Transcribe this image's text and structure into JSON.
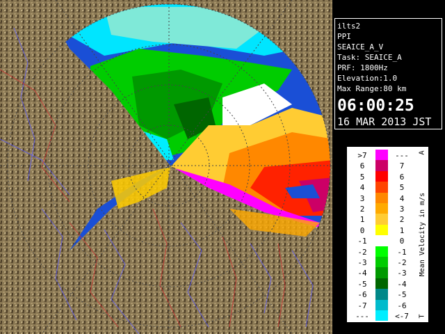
{
  "info": {
    "site": "ilts2",
    "scan_type": "PPI",
    "product": "SEAICE_A_V",
    "task": "Task: SEAICE_A",
    "prf": "PRF: 1800Hz",
    "elevation": "Elevation:1.0",
    "max_range": "Max Range:80 km",
    "time": "06:00:25",
    "date": "16 MAR 2013 JST"
  },
  "legend": {
    "title": "Mean Velocity in m/s",
    "corner_top": "A",
    "corner_bottom": "T",
    "rows": [
      {
        "left": ">7",
        "right": "---",
        "color": "#ff00ff"
      },
      {
        "left": "6",
        "right": "7",
        "color": "#cc0066"
      },
      {
        "left": "5",
        "right": "6",
        "color": "#ff0000"
      },
      {
        "left": "4",
        "right": "5",
        "color": "#ff4400"
      },
      {
        "left": "3",
        "right": "4",
        "color": "#ff8800"
      },
      {
        "left": "2",
        "right": "3",
        "color": "#ffaa00"
      },
      {
        "left": "1",
        "right": "2",
        "color": "#ffcc33"
      },
      {
        "left": "0",
        "right": "1",
        "color": "#ffff00"
      },
      {
        "left": "-1",
        "right": "0",
        "color": "#ffffff"
      },
      {
        "left": "-2",
        "right": "-1",
        "color": "#00ff00"
      },
      {
        "left": "-3",
        "right": "-2",
        "color": "#00cc00"
      },
      {
        "left": "-4",
        "right": "-3",
        "color": "#009900"
      },
      {
        "left": "-5",
        "right": "-4",
        "color": "#006600"
      },
      {
        "left": "-6",
        "right": "-5",
        "color": "#008888"
      },
      {
        "left": "-7",
        "right": "-6",
        "color": "#00bbcc"
      },
      {
        "left": "---",
        "right": "<-7",
        "color": "#00eeff"
      }
    ]
  },
  "colors": {
    "range_circle_fill": "#1a4fd6",
    "terrain": "#7a6a4a",
    "background": "#000000"
  }
}
